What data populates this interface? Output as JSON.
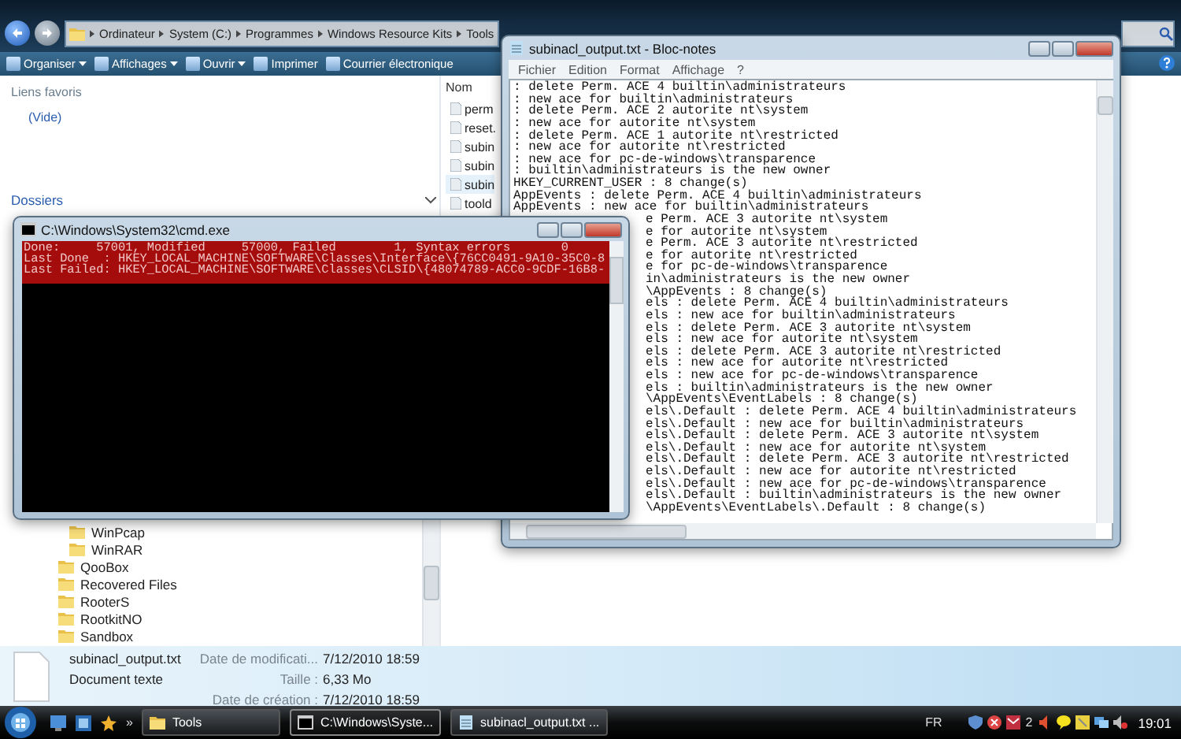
{
  "explorer": {
    "breadcrumb": [
      "Ordinateur",
      "System (C:)",
      "Programmes",
      "Windows Resource Kits",
      "Tools"
    ],
    "toolbar": [
      {
        "label": "Organiser",
        "dropdown": true
      },
      {
        "label": "Affichages",
        "dropdown": true
      },
      {
        "label": "Ouvrir",
        "dropdown": true
      },
      {
        "label": "Imprimer",
        "dropdown": false
      },
      {
        "label": "Courrier électronique",
        "dropdown": false
      }
    ],
    "favorites": {
      "title": "Liens favoris",
      "items": [
        "(Vide)"
      ]
    },
    "folders": {
      "title": "Dossiers",
      "tree": [
        {
          "children": [
            {
              "name": "WinPcap"
            },
            {
              "name": "WinRAR"
            }
          ]
        },
        {
          "name": "QooBox"
        },
        {
          "name": "Recovered Files"
        },
        {
          "name": "RooterS"
        },
        {
          "name": "RootkitNO"
        },
        {
          "name": "Sandbox"
        }
      ]
    },
    "file_list": {
      "column": "Nom",
      "items": [
        {
          "name": "perm",
          "selected": false
        },
        {
          "name": "reset.",
          "selected": false
        },
        {
          "name": "subin",
          "selected": false
        },
        {
          "name": "subin",
          "selected": false
        },
        {
          "name": "subin",
          "selected": true
        },
        {
          "name": "toold",
          "selected": false
        }
      ]
    },
    "details": {
      "name": "subinacl_output.txt",
      "type": "Document texte",
      "fields": [
        {
          "label": "Date de modificati...",
          "value": "7/12/2010 18:59"
        },
        {
          "label": "Taille :",
          "value": "6,33 Mo"
        },
        {
          "label": "Date de création :",
          "value": "7/12/2010 18:59"
        }
      ]
    }
  },
  "notepad": {
    "title": "subinacl_output.txt - Bloc-notes",
    "menu": [
      "Fichier",
      "Edition",
      "Format",
      "Affichage",
      "?"
    ],
    "lines": [
      {
        "text": ": delete Perm. ACE 4 builtin\\administrateurs",
        "kind": "full"
      },
      {
        "text": ": new ace for builtin\\administrateurs",
        "kind": "full"
      },
      {
        "text": ": delete Perm. ACE 2 autorite nt\\system",
        "kind": "full"
      },
      {
        "text": ": new ace for autorite nt\\system",
        "kind": "full"
      },
      {
        "text": ": delete Perm. ACE 1 autorite nt\\restricted",
        "kind": "full"
      },
      {
        "text": ": new ace for autorite nt\\restricted",
        "kind": "full"
      },
      {
        "text": ": new ace for pc-de-windows\\transparence",
        "kind": "full"
      },
      {
        "text": ": builtin\\administrateurs is the new owner",
        "kind": "full"
      },
      {
        "text": "HKEY_CURRENT_USER : 8 change(s)",
        "kind": "full"
      },
      {
        "text": "AppEvents : delete Perm. ACE 4 builtin\\administrateurs",
        "kind": "full"
      },
      {
        "text": "AppEvents : new ace for builtin\\administrateurs",
        "kind": "full"
      },
      {
        "text": "e Perm. ACE 3 autorite nt\\system",
        "kind": "partial"
      },
      {
        "text": "e for autorite nt\\system",
        "kind": "partial"
      },
      {
        "text": "e Perm. ACE 3 autorite nt\\restricted",
        "kind": "partial"
      },
      {
        "text": "e for autorite nt\\restricted",
        "kind": "partial"
      },
      {
        "text": "e for pc-de-windows\\transparence",
        "kind": "partial"
      },
      {
        "text": "in\\administrateurs is the new owner",
        "kind": "partial"
      },
      {
        "text": "\\AppEvents : 8 change(s)",
        "kind": "partial"
      },
      {
        "text": "els : delete Perm. ACE 4 builtin\\administrateurs",
        "kind": "partial"
      },
      {
        "text": "els : new ace for builtin\\administrateurs",
        "kind": "partial"
      },
      {
        "text": "els : delete Perm. ACE 3 autorite nt\\system",
        "kind": "partial"
      },
      {
        "text": "els : new ace for autorite nt\\system",
        "kind": "partial"
      },
      {
        "text": "els : delete Perm. ACE 3 autorite nt\\restricted",
        "kind": "partial"
      },
      {
        "text": "els : new ace for autorite nt\\restricted",
        "kind": "partial"
      },
      {
        "text": "els : new ace for pc-de-windows\\transparence",
        "kind": "partial"
      },
      {
        "text": "els : builtin\\administrateurs is the new owner",
        "kind": "partial"
      },
      {
        "text": "\\AppEvents\\EventLabels : 8 change(s)",
        "kind": "partial"
      },
      {
        "text": "els\\.Default : delete Perm. ACE 4 builtin\\administrateurs",
        "kind": "partial"
      },
      {
        "text": "els\\.Default : new ace for builtin\\administrateurs",
        "kind": "partial"
      },
      {
        "text": "els\\.Default : delete Perm. ACE 3 autorite nt\\system",
        "kind": "partial"
      },
      {
        "text": "els\\.Default : new ace for autorite nt\\system",
        "kind": "partial"
      },
      {
        "text": "els\\.Default : delete Perm. ACE 3 autorite nt\\restricted",
        "kind": "partial"
      },
      {
        "text": "els\\.Default : new ace for autorite nt\\restricted",
        "kind": "partial"
      },
      {
        "text": "els\\.Default : new ace for pc-de-windows\\transparence",
        "kind": "partial"
      },
      {
        "text": "els\\.Default : builtin\\administrateurs is the new owner",
        "kind": "partial"
      },
      {
        "text": "\\AppEvents\\EventLabels\\.Default : 8 change(s)",
        "kind": "partial"
      }
    ]
  },
  "cmd": {
    "title": "C:\\Windows\\System32\\cmd.exe",
    "lines": [
      "Done:     57001, Modified     57000, Failed        1, Syntax errors       0",
      "Last Done  : HKEY_LOCAL_MACHINE\\SOFTWARE\\Classes\\Interface\\{76CC0491-9A10-35C0-8",
      "Last Failed: HKEY_LOCAL_MACHINE\\SOFTWARE\\Classes\\CLSID\\{48074789-ACC0-9CDF-16B8-"
    ]
  },
  "taskbar": {
    "overflow": "»",
    "buttons": [
      {
        "label": "Tools",
        "kind": "folder",
        "selected": false
      },
      {
        "label": "C:\\Windows\\Syste...",
        "kind": "console",
        "selected": true
      },
      {
        "label": "subinacl_output.txt ...",
        "kind": "notepad",
        "selected": false
      }
    ],
    "language": "FR",
    "tray_badge": "2",
    "clock": "19:01"
  }
}
